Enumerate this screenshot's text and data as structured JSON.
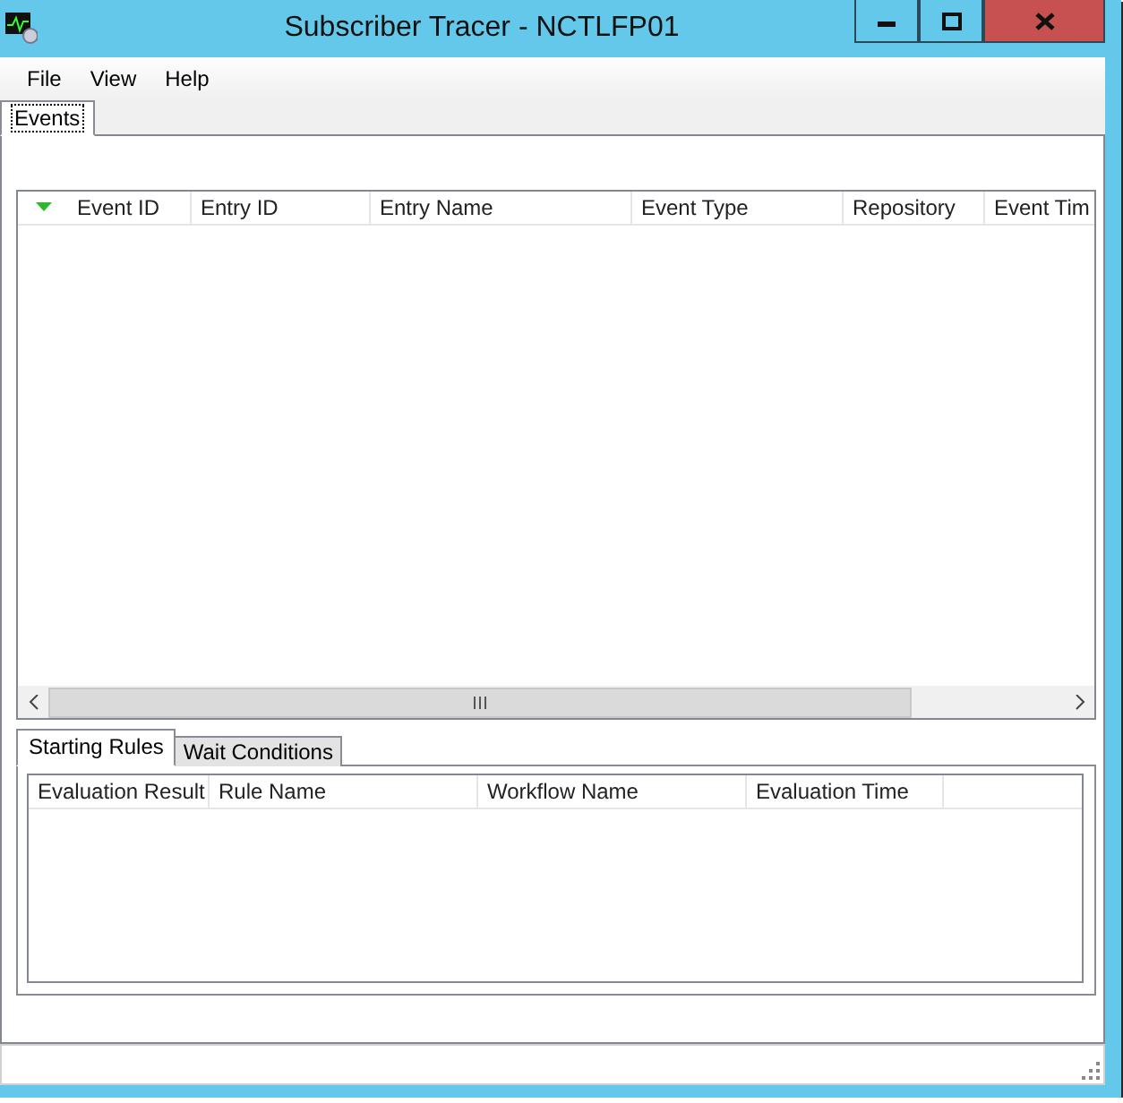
{
  "window": {
    "title": "Subscriber Tracer - NCTLFP01"
  },
  "menu": [
    {
      "label": "File"
    },
    {
      "label": "View"
    },
    {
      "label": "Help"
    }
  ],
  "tabs": [
    {
      "label": "Events",
      "selected": true
    }
  ],
  "events_table": {
    "columns": [
      {
        "label": "Event ID",
        "sorted": true
      },
      {
        "label": "Entry ID",
        "sorted": false
      },
      {
        "label": "Entry Name",
        "sorted": false
      },
      {
        "label": "Event Type",
        "sorted": false
      },
      {
        "label": "Repository",
        "sorted": false
      },
      {
        "label": "Event Tim",
        "sorted": false
      }
    ]
  },
  "detail_tabs": [
    {
      "label": "Starting Rules",
      "selected": true
    },
    {
      "label": "Wait Conditions",
      "selected": false
    }
  ],
  "rules_table": {
    "columns": [
      {
        "label": "Evaluation Result"
      },
      {
        "label": "Rule Name"
      },
      {
        "label": "Workflow Name"
      },
      {
        "label": "Evaluation Time"
      }
    ]
  }
}
